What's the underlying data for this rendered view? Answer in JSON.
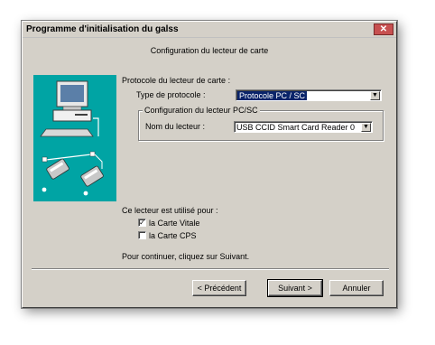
{
  "window": {
    "title": "Programme d'initialisation du galss",
    "close_glyph": "✕"
  },
  "header": {
    "title": "Configuration du lecteur de carte"
  },
  "protocol_section": {
    "heading": "Protocole du lecteur de carte :",
    "type_label": "Type de protocole :",
    "type_value": "Protocole PC / SC"
  },
  "pcsc_group": {
    "title": "Configuration du lecteur PC/SC",
    "reader_label": "Nom du lecteur :",
    "reader_value": "USB CCID Smart Card Reader 0"
  },
  "usage_section": {
    "heading": "Ce lecteur est utilisé pour :",
    "options": [
      {
        "label": "la Carte Vitale",
        "checked": true
      },
      {
        "label": "la Carte CPS",
        "checked": false
      }
    ]
  },
  "instruction": "Pour continuer, cliquez sur Suivant.",
  "buttons": {
    "back": "< Précédent",
    "next": "Suivant >",
    "cancel": "Annuler"
  },
  "icons": {
    "dropdown": "▼",
    "check": "✓"
  },
  "colors": {
    "dialog_bg": "#d4d0c8",
    "graphic_bg": "#00a4a4",
    "selection_bg": "#0a246a",
    "close_btn": "#c75050"
  }
}
